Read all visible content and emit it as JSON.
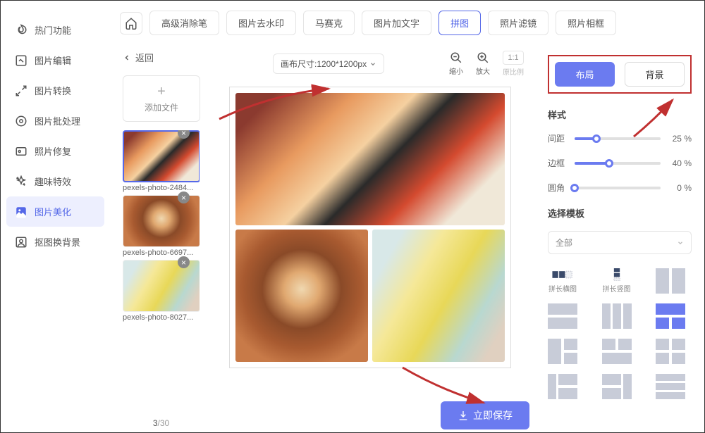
{
  "sidebar": {
    "items": [
      {
        "label": "热门功能",
        "icon": "flame-icon"
      },
      {
        "label": "图片编辑",
        "icon": "image-edit-icon"
      },
      {
        "label": "图片转换",
        "icon": "convert-icon"
      },
      {
        "label": "图片批处理",
        "icon": "batch-icon"
      },
      {
        "label": "照片修复",
        "icon": "repair-icon"
      },
      {
        "label": "趣味特效",
        "icon": "effects-icon"
      },
      {
        "label": "图片美化",
        "icon": "beautify-icon"
      },
      {
        "label": "抠图换背景",
        "icon": "cutout-icon"
      }
    ],
    "active_index": 6
  },
  "topbar": {
    "tabs": [
      "高级消除笔",
      "图片去水印",
      "马赛克",
      "图片加文字",
      "拼图",
      "照片滤镜",
      "照片相框"
    ],
    "active_index": 4
  },
  "back_label": "返回",
  "add_file_label": "添加文件",
  "canvas_size_label": "画布尺寸:1200*1200px",
  "zoom_out_label": "缩小",
  "zoom_in_label": "放大",
  "ratio_btn": "1:1",
  "ratio_label": "原比例",
  "save_btn": "立即保存",
  "thumbs": [
    {
      "name": "pexels-photo-2484..."
    },
    {
      "name": "pexels-photo-6697..."
    },
    {
      "name": "pexels-photo-8027..."
    }
  ],
  "count_current": "3",
  "count_total": "/30",
  "rpanel": {
    "tabs": [
      "布局",
      "背景"
    ],
    "active_index": 0,
    "style_title": "样式",
    "sliders": [
      {
        "label": "间距",
        "value": 25,
        "unit": "%"
      },
      {
        "label": "边框",
        "value": 40,
        "unit": "%"
      },
      {
        "label": "圆角",
        "value": 0,
        "unit": "%"
      }
    ],
    "template_title": "选择模板",
    "template_filter": "全部",
    "tpl_labels": [
      "拼长横图",
      "拼长竖图"
    ]
  }
}
